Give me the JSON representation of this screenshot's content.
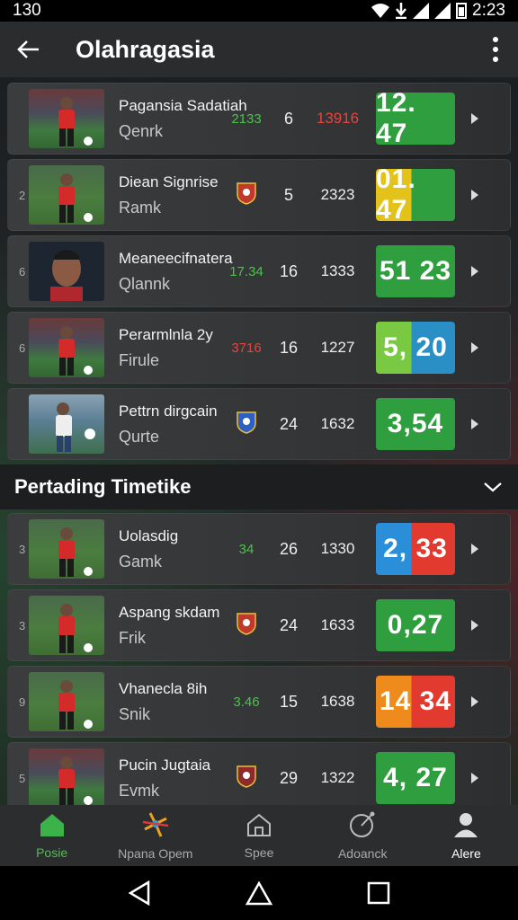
{
  "status": {
    "time_left": "130",
    "time_right": "2:23"
  },
  "header": {
    "title": "Olahragasia"
  },
  "rows_top": [
    {
      "idx": "",
      "name": "Pagansia Sadatiah",
      "sub": "Qenrk",
      "mid": "2133",
      "mid_color": "green",
      "n1": "6",
      "n2": "13916",
      "n2_color": "red",
      "score": "12. 47",
      "score_bg": "#2e9e3f",
      "thumb": "crowd"
    },
    {
      "idx": "2",
      "name": "Diean Signrise",
      "sub": "Ramk",
      "mid": "badge",
      "badge_color": "#c0392b",
      "n1": "5",
      "n2": "2323",
      "n2_color": "",
      "score": "01. 47",
      "score_bg": "split-yellow",
      "thumb": "field"
    },
    {
      "idx": "6",
      "name": "Meaneecifnatera",
      "sub": "Qlannk",
      "mid": "17.34",
      "mid_color": "green",
      "n1": "16",
      "n2": "1333",
      "n2_color": "",
      "score": "51 23",
      "score_bg": "#2e9e3f",
      "thumb": "portrait"
    },
    {
      "idx": "6",
      "name": "Perarmlnla 2y",
      "sub": "Firule",
      "mid": "3716",
      "mid_color": "red",
      "n1": "16",
      "n2": "1227",
      "n2_color": "",
      "score": "5, 20",
      "score_bg": "split-lightgreen",
      "thumb": "crowd"
    },
    {
      "idx": "",
      "name": "Pettrn dirgcain",
      "sub": "Qurte",
      "mid": "badge",
      "badge_color": "#2f5fbf",
      "n1": "24",
      "n2": "1632",
      "n2_color": "",
      "score": "3,54",
      "score_bg": "#2e9e3f",
      "thumb": "white"
    }
  ],
  "section": {
    "title": "Pertading Timetike"
  },
  "rows_bottom": [
    {
      "idx": "3",
      "name": "Uolasdig",
      "sub": "Gamk",
      "mid": "34",
      "mid_color": "green",
      "n1": "26",
      "n2": "1330",
      "n2_color": "",
      "score": "2, 33",
      "score_bg": "split-bluered",
      "thumb": "field"
    },
    {
      "idx": "3",
      "name": "Aspang skdam",
      "sub": "Frik",
      "mid": "badge",
      "badge_color": "#c0392b",
      "n1": "24",
      "n2": "1633",
      "n2_color": "",
      "score": "0,27",
      "score_bg": "#2e9e3f",
      "thumb": "field"
    },
    {
      "idx": "9",
      "name": "Vhanecla 8ih",
      "sub": "Snik",
      "mid": "3.46",
      "mid_color": "green",
      "n1": "15",
      "n2": "1638",
      "n2_color": "",
      "score": "14 34",
      "score_bg": "split-orangered",
      "thumb": "field"
    },
    {
      "idx": "5",
      "name": "Pucin Jugtaia",
      "sub": "Evmk",
      "mid": "badge",
      "badge_color": "#8e2a2a",
      "n1": "29",
      "n2": "1322",
      "n2_color": "",
      "score": "4, 27",
      "score_bg": "#2e9e3f",
      "thumb": "crowd"
    }
  ],
  "bottom_nav": [
    {
      "label": "Posie",
      "icon": "home-icon",
      "state": "active-green"
    },
    {
      "label": "Npana Opem",
      "icon": "sparkle-icon",
      "state": ""
    },
    {
      "label": "Spee",
      "icon": "house-outline-icon",
      "state": ""
    },
    {
      "label": "Adoanck",
      "icon": "ball-icon",
      "state": ""
    },
    {
      "label": "Alere",
      "icon": "profile-icon",
      "state": "active-white"
    }
  ],
  "colors": {
    "green": "#4cc24c",
    "red": "#e5453d",
    "appbar": "#2a2c2e"
  }
}
